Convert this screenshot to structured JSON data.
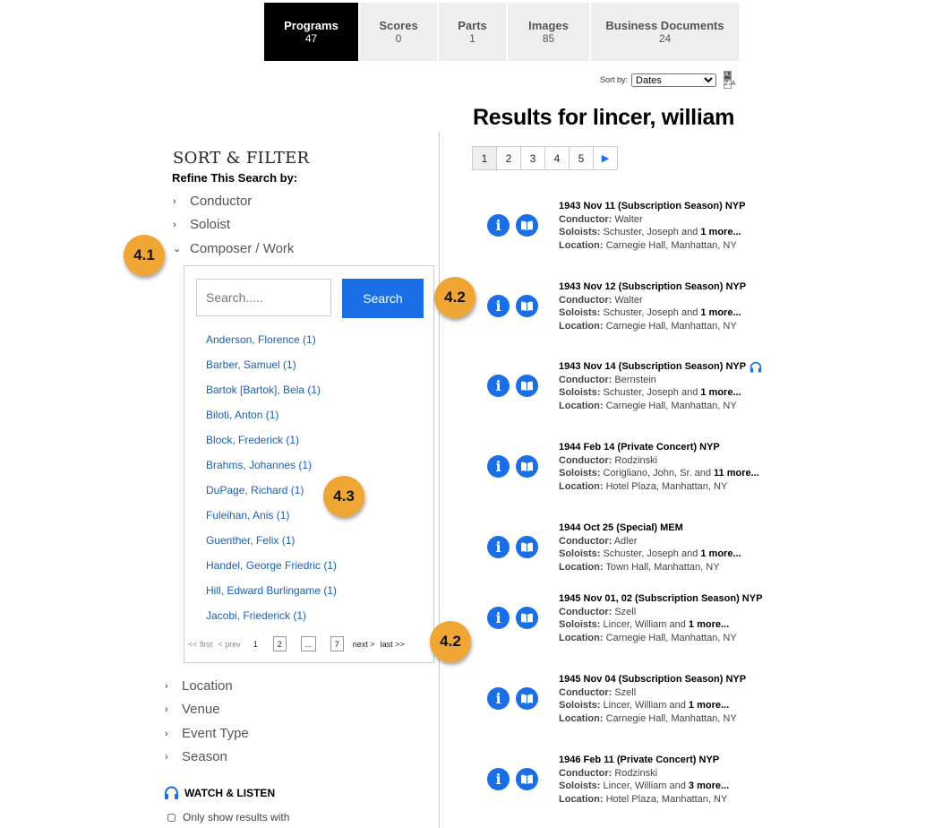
{
  "tabs": [
    {
      "label": "Programs",
      "count": "47"
    },
    {
      "label": "Scores",
      "count": "0"
    },
    {
      "label": "Parts",
      "count": "1"
    },
    {
      "label": "Images",
      "count": "85"
    },
    {
      "label": "Business Documents",
      "count": "24"
    }
  ],
  "sort": {
    "label": "Sort by:",
    "value": "Dates",
    "az_top": "A↓Z",
    "az_bottom": "Z↓A"
  },
  "results_title": "Results for lincer, william",
  "pager": {
    "pages": [
      "1",
      "2",
      "3",
      "4",
      "5"
    ],
    "next": "▶"
  },
  "sidebar": {
    "heading": "SORT & FILTER",
    "subheading": "Refine This Search by:",
    "facets_top": [
      "Conductor",
      "Soloist",
      "Composer / Work"
    ],
    "facets_bottom": [
      "Location",
      "Venue",
      "Event Type",
      "Season"
    ],
    "chevron_closed": "›",
    "chevron_open": "⌄"
  },
  "composer_panel": {
    "search_placeholder": "Search.....",
    "search_button": "Search",
    "composers": [
      "Anderson, Florence (1)",
      "Barber, Samuel (1)",
      "Bartok [Bartok], Bela (1)",
      "Biloti, Anton (1)",
      "Block, Frederick (1)",
      "Brahms, Johannes (1)",
      "DuPage, Richard (1)",
      "Fuleihan, Anis (1)",
      "Guenther, Felix (1)",
      "Handel, George Friedric (1)",
      "Hill, Edward Burlingame (1)",
      "Jacobi, Friederick (1)"
    ],
    "pager": {
      "first": "<< first",
      "prev": "< prev",
      "current": "1",
      "p2": "2",
      "ellipsis": "...",
      "last_page": "7",
      "next": "next >",
      "last": "last >>"
    }
  },
  "badges": [
    "4.1",
    "4.2",
    "4.3",
    "4.2"
  ],
  "watch_listen": {
    "title": "WATCH & LISTEN",
    "checkbox_label": "Only show results with"
  },
  "labels": {
    "conductor": "Conductor:",
    "soloists": "Soloists:",
    "location": "Location:"
  },
  "results": [
    {
      "title": "1943 Nov 11 (Subscription Season) NYP",
      "conductor": "Walter",
      "soloists": "Schuster, Joseph and",
      "more": "1 more...",
      "location": "Carnegie Hall, Manhattan, NY",
      "audio": false
    },
    {
      "title": "1943 Nov 12 (Subscription Season) NYP",
      "conductor": "Walter",
      "soloists": "Schuster, Joseph and",
      "more": "1 more...",
      "location": "Carnegie Hall, Manhattan, NY",
      "audio": false
    },
    {
      "title": "1943 Nov 14 (Subscription Season) NYP",
      "conductor": "Bernstein",
      "soloists": "Schuster, Joseph and",
      "more": "1 more...",
      "location": "Carnegie Hall, Manhattan, NY",
      "audio": true
    },
    {
      "title": "1944 Feb 14 (Private Concert) NYP",
      "conductor": "Rodzinski",
      "soloists": "Corigliano, John, Sr. and",
      "more": "11 more...",
      "location": "Hotel Plaza, Manhattan, NY",
      "audio": false
    },
    {
      "title": "1944 Oct 25 (Special) MEM",
      "conductor": "Adler",
      "soloists": "Schuster, Joseph and",
      "more": "1 more...",
      "location": "Town Hall, Manhattan, NY",
      "audio": false
    },
    {
      "title": "1945 Nov 01, 02 (Subscription Season) NYP",
      "conductor": "Szell",
      "soloists": "Lincer, William and",
      "more": "1 more...",
      "location": "Carnegie Hall, Manhattan, NY",
      "audio": false
    },
    {
      "title": "1945 Nov 04 (Subscription Season) NYP",
      "conductor": "Szell",
      "soloists": "Lincer, William and",
      "more": "1 more...",
      "location": "Carnegie Hall, Manhattan, NY",
      "audio": false
    },
    {
      "title": "1946 Feb 11 (Private Concert) NYP",
      "conductor": "Rodzinski",
      "soloists": "Lincer, William and",
      "more": "3 more...",
      "location": "Hotel Plaza, Manhattan, NY",
      "audio": false
    }
  ]
}
